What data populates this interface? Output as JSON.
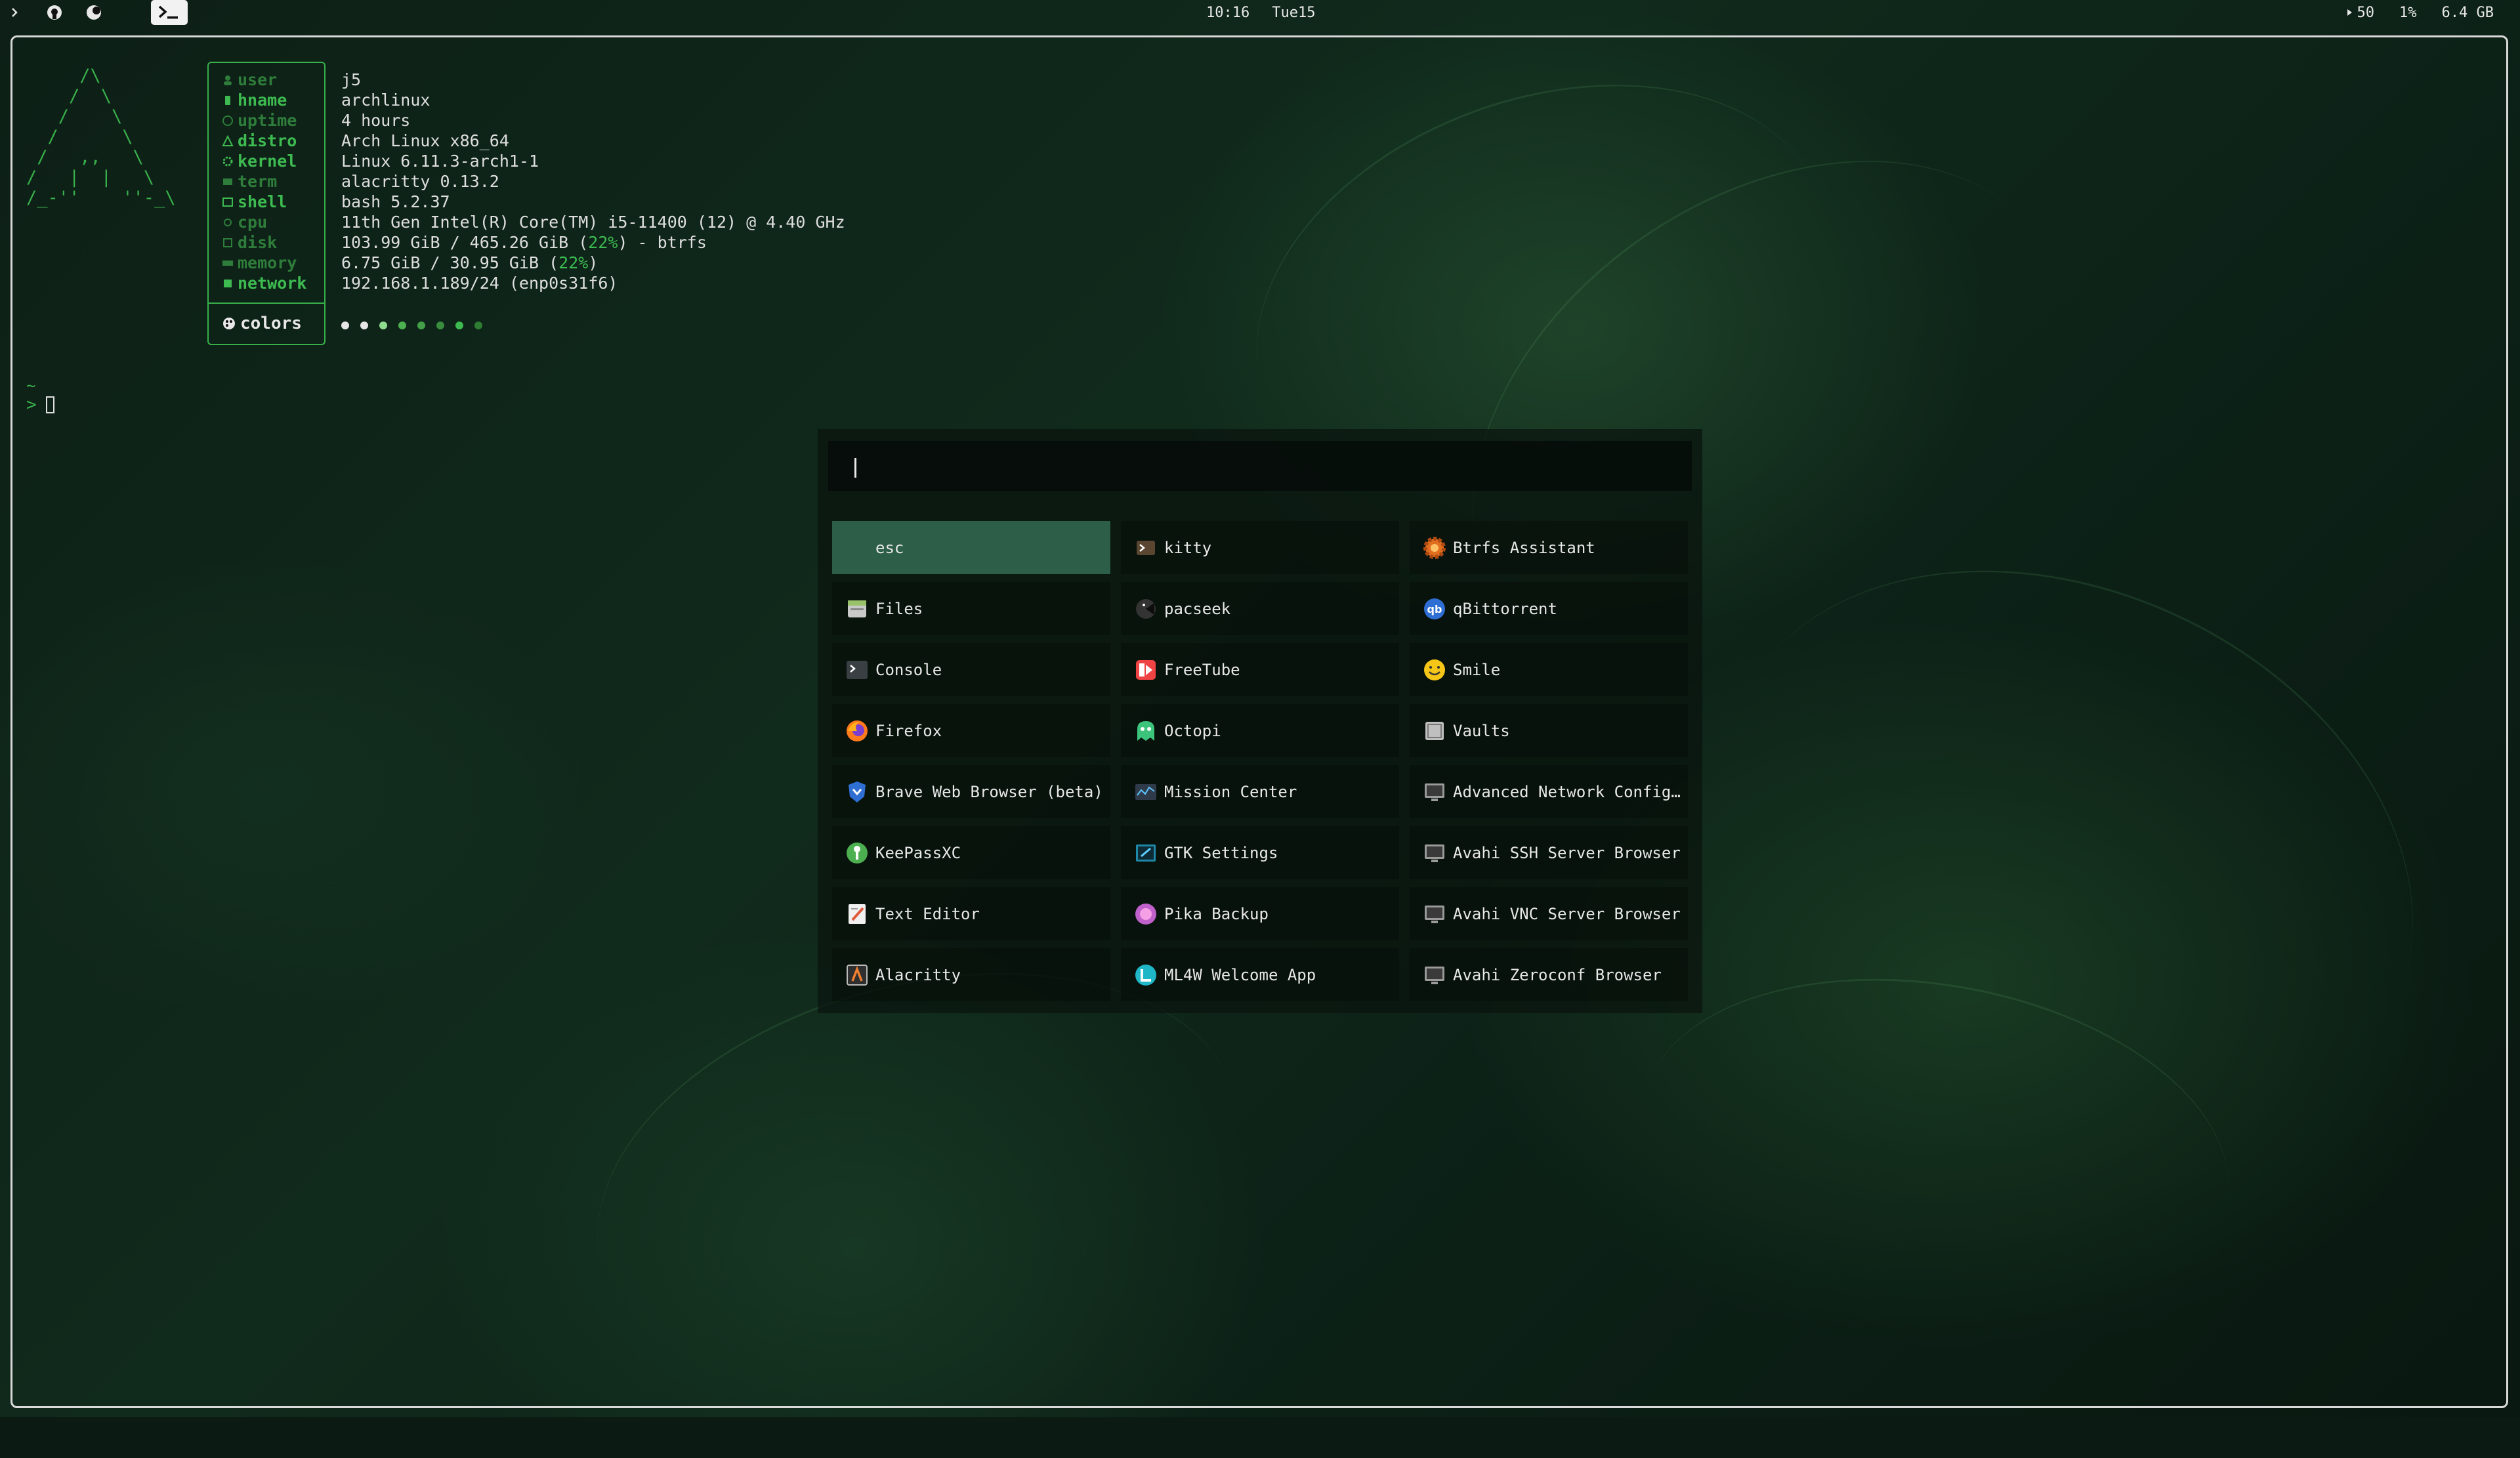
{
  "topbar": {
    "time": "10:16",
    "date": "Tue15",
    "volume": "50",
    "cpu": "1%",
    "memory": "6.4 GB"
  },
  "fetch": {
    "labels": [
      "user",
      "hname",
      "uptime",
      "distro",
      "kernel",
      "term",
      "shell",
      "cpu",
      "disk",
      "memory",
      "network"
    ],
    "values": [
      "j5",
      "archlinux",
      "4 hours",
      "Arch Linux x86_64",
      "Linux 6.11.3-arch1-1",
      "alacritty 0.13.2",
      "bash 5.2.37",
      "11th Gen Intel(R) Core(TM) i5-11400 (12) @ 4.40 GHz"
    ],
    "disk_main": "103.99 GiB / 465.26 GiB (",
    "disk_pct": "22%",
    "disk_tail": ") - btrfs",
    "mem_main": "6.75 GiB / 30.95 GiB (",
    "mem_pct": "22%",
    "mem_tail": ")",
    "network_value": "192.168.1.189/24 (enp0s31f6)",
    "colors_label": "colors",
    "dot_colors": [
      "#e6e6e6",
      "#e6e6e6",
      "#8fdc8f",
      "#4caf50",
      "#43a047",
      "#388e3c",
      "#3dbb50",
      "#2e7d32"
    ]
  },
  "terminal": {
    "prompt_dir": "~",
    "prompt_symbol": ">"
  },
  "launcher": {
    "search_value": "",
    "apps": [
      {
        "label": "esc",
        "icon": ""
      },
      {
        "label": "kitty",
        "icon": "kitty-icon"
      },
      {
        "label": "Btrfs Assistant",
        "icon": "btrfs-assistant-icon"
      },
      {
        "label": "Files",
        "icon": "files-icon"
      },
      {
        "label": "pacseek",
        "icon": "pacseek-icon"
      },
      {
        "label": "qBittorrent",
        "icon": "qbittorrent-icon"
      },
      {
        "label": "Console",
        "icon": "console-icon"
      },
      {
        "label": "FreeTube",
        "icon": "freetube-icon"
      },
      {
        "label": "Smile",
        "icon": "smile-icon"
      },
      {
        "label": "Firefox",
        "icon": "firefox-icon"
      },
      {
        "label": "Octopi",
        "icon": "octopi-icon"
      },
      {
        "label": "Vaults",
        "icon": "vaults-icon"
      },
      {
        "label": "Brave Web Browser (beta)",
        "icon": "brave-icon"
      },
      {
        "label": "Mission Center",
        "icon": "mission-center-icon"
      },
      {
        "label": "Advanced Network Configu…",
        "icon": "network-config-icon"
      },
      {
        "label": "KeePassXC",
        "icon": "keepassxc-icon"
      },
      {
        "label": "GTK Settings",
        "icon": "gtk-settings-icon"
      },
      {
        "label": "Avahi SSH Server Browser",
        "icon": "avahi-ssh-icon"
      },
      {
        "label": "Text Editor",
        "icon": "text-editor-icon"
      },
      {
        "label": "Pika Backup",
        "icon": "pika-backup-icon"
      },
      {
        "label": "Avahi VNC Server Browser",
        "icon": "avahi-vnc-icon"
      },
      {
        "label": "Alacritty",
        "icon": "alacritty-icon"
      },
      {
        "label": "ML4W Welcome App",
        "icon": "ml4w-icon"
      },
      {
        "label": "Avahi Zeroconf Browser",
        "icon": "avahi-zeroconf-icon"
      }
    ],
    "active_color": "#2c5e48"
  }
}
